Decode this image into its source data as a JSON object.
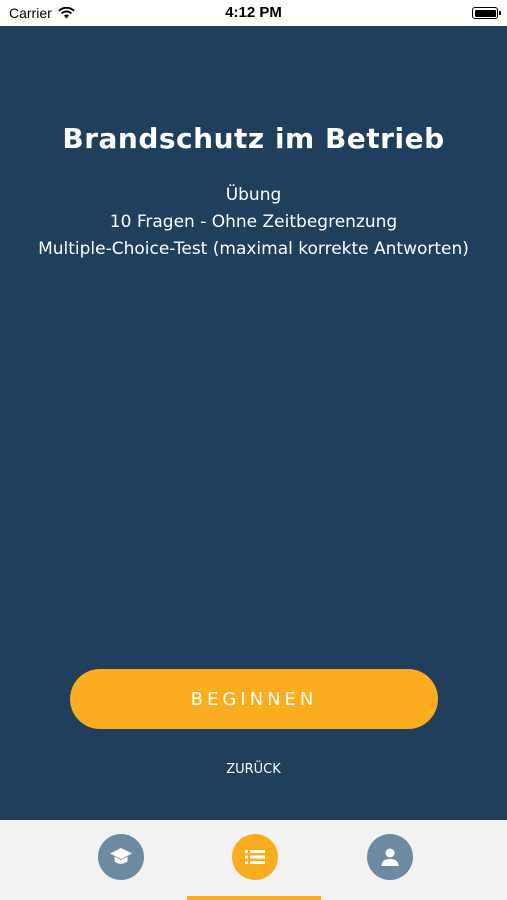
{
  "status_bar": {
    "carrier": "Carrier",
    "time": "4:12 PM"
  },
  "course": {
    "title": "Brandschutz im Betrieb",
    "mode": "Übung",
    "questions": "10 Fragen - Ohne Zeitbegrenzung",
    "test_type": "Multiple-Choice-Test (maximal korrekte Antworten)"
  },
  "actions": {
    "start_label": "BEGINNEN",
    "back_label": "ZURÜCK"
  },
  "tab_bar": {
    "tabs": [
      {
        "icon": "graduation-cap-icon"
      },
      {
        "icon": "list-icon",
        "active": true
      },
      {
        "icon": "user-icon"
      }
    ]
  },
  "colors": {
    "background": "#1f3f5d",
    "accent": "#fbad1f",
    "tab_inactive": "#6e8aa3"
  }
}
